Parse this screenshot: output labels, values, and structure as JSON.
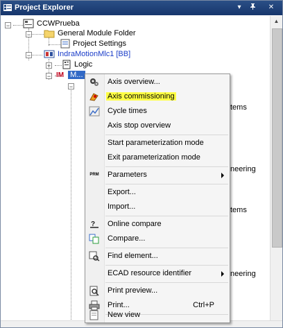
{
  "window": {
    "title": "Project Explorer",
    "dropdown_glyph": "▾",
    "pin_glyph": "📌",
    "close_glyph": "✕"
  },
  "tree": {
    "root": "CCWPrueba",
    "folder": "General Module Folder",
    "settings": "Project Settings",
    "device": "IndraMotionMlc1 [BB]",
    "logic": "Logic",
    "selected_prefix": "IM",
    "selected_label": "M..."
  },
  "background_fragments": [
    "tems",
    "neering",
    "tems",
    "neering"
  ],
  "menu": {
    "items": [
      {
        "label": "Axis overview...",
        "icon": "axis-overview-icon"
      },
      {
        "label": "Axis commissioning",
        "icon": "axis-commissioning-icon",
        "highlighted": true
      },
      {
        "label": "Cycle times",
        "icon": "cycle-times-icon"
      },
      {
        "label": "Axis stop overview",
        "icon": ""
      },
      {
        "label": "Start parameterization mode",
        "icon": ""
      },
      {
        "label": "Exit parameterization mode",
        "icon": ""
      },
      {
        "label": "Parameters",
        "icon": "parameters-icon",
        "submenu": true
      },
      {
        "label": "Export...",
        "icon": ""
      },
      {
        "label": "Import...",
        "icon": ""
      },
      {
        "label": "Online compare",
        "icon": "online-compare-icon"
      },
      {
        "label": "Compare...",
        "icon": "compare-icon"
      },
      {
        "label": "Find element...",
        "icon": "find-element-icon"
      },
      {
        "label": "ECAD resource identifier",
        "icon": "",
        "submenu": true
      },
      {
        "label": "Print preview...",
        "icon": "print-preview-icon"
      },
      {
        "label": "Print...",
        "icon": "print-icon",
        "shortcut": "Ctrl+P"
      },
      {
        "label": "New view",
        "icon": "new-view-icon"
      }
    ],
    "parameters_badge": "PRM"
  },
  "colors": {
    "title_bar": "#1f4280",
    "highlight": "#ffff44",
    "selection": "#3169c6"
  }
}
